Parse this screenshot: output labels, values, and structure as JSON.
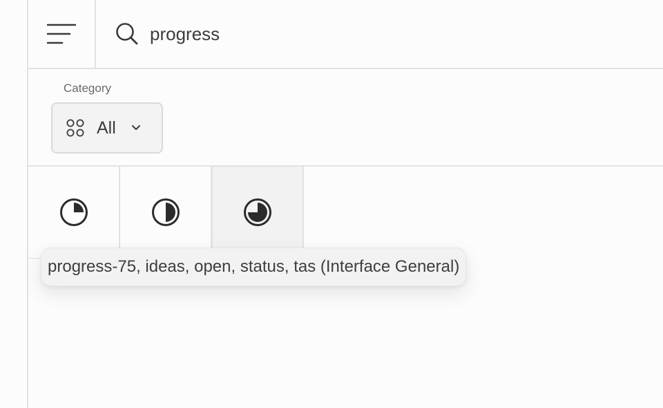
{
  "header": {
    "menu_icon": "hamburger-menu-icon",
    "search_icon": "search-icon",
    "search_value": "progress"
  },
  "filters": {
    "category_label": "Category",
    "category_value": "All",
    "category_icon": "grid-icon"
  },
  "results": {
    "icons": [
      {
        "name": "progress-25-icon"
      },
      {
        "name": "progress-50-icon"
      },
      {
        "name": "progress-75-icon",
        "hovered": true
      }
    ],
    "tooltip": "progress-75, ideas, open, status, tas (Interface General)"
  },
  "colors": {
    "background": "#fcfcfc",
    "border": "#e2e2e2",
    "icon": "#2b2b2b",
    "hover_tile": "#f2f2f2"
  }
}
